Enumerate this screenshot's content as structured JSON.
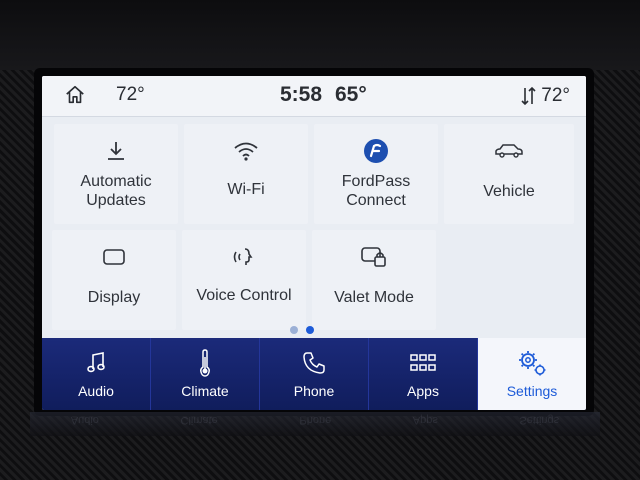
{
  "status": {
    "cabin_temp_left": "72°",
    "time": "5:58",
    "outside_temp": "65°",
    "cabin_temp_right": "72°"
  },
  "tiles": [
    {
      "label": "Automatic\nUpdates",
      "icon": "download-icon"
    },
    {
      "label": "Wi-Fi",
      "icon": "wifi-icon"
    },
    {
      "label": "FordPass\nConnect",
      "icon": "fordpass-icon"
    },
    {
      "label": "Vehicle",
      "icon": "car-icon"
    },
    {
      "label": "Display",
      "icon": "display-icon"
    },
    {
      "label": "Voice Control",
      "icon": "voice-icon"
    },
    {
      "label": "Valet Mode",
      "icon": "valet-lock-icon"
    }
  ],
  "page_indicator": {
    "current_page": 2,
    "total_pages": 2
  },
  "dock": [
    {
      "label": "Audio",
      "icon": "music-note-icon"
    },
    {
      "label": "Climate",
      "icon": "thermometer-icon"
    },
    {
      "label": "Phone",
      "icon": "phone-icon"
    },
    {
      "label": "Apps",
      "icon": "apps-grid-icon"
    },
    {
      "label": "Settings",
      "icon": "settings-gears-icon",
      "selected": true
    }
  ],
  "reflection": [
    "Audio",
    "Climate",
    "Phone",
    "Apps",
    "Settings"
  ],
  "colors": {
    "accent": "#1d5bd8",
    "dock_bg": "#1b2a7a",
    "screen_bg": "#e9edf3",
    "fordpass_blue": "#1d4fb0"
  }
}
